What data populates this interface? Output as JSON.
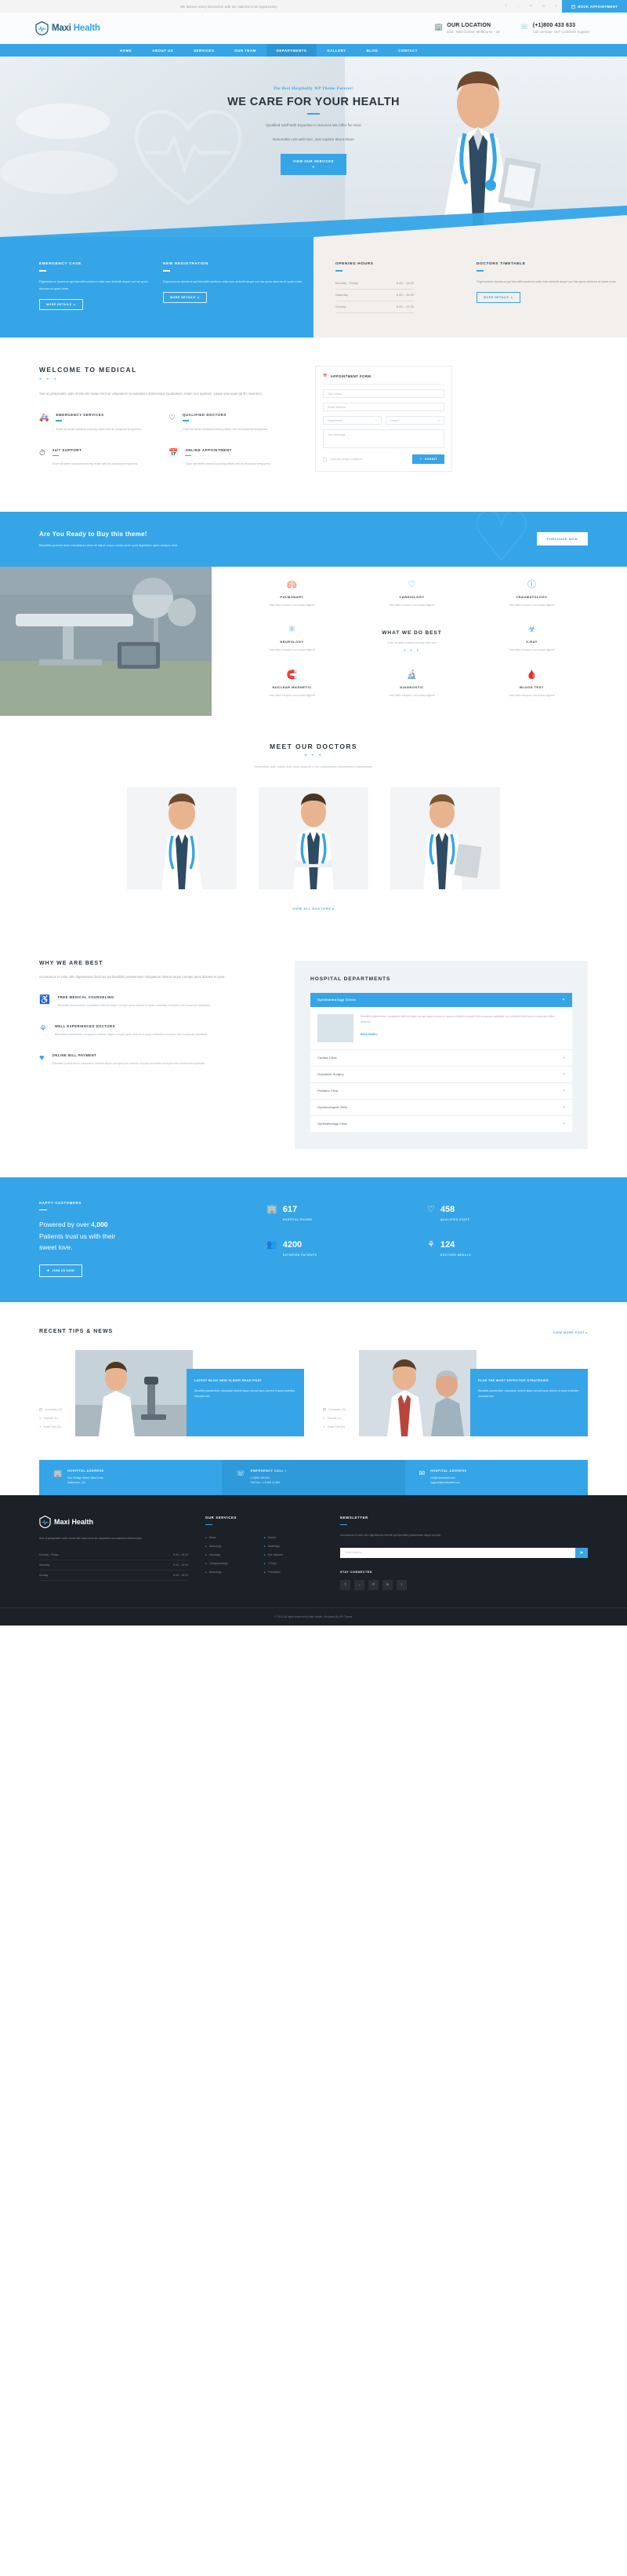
{
  "topbar": {
    "tagline": "We believe every interaction with our patients is an opportunity!",
    "socials": [
      "f",
      "ᵥ",
      "✕",
      "in",
      "t"
    ],
    "book_label": "BOOK APPOINTMENT",
    "book_icon": "calendar-icon"
  },
  "header": {
    "brand_first": "Maxi ",
    "brand_second": "Health",
    "contacts": [
      {
        "icon": "location-icon",
        "title": "OUR LOCATION",
        "sub": "Eaa - Web Corner, Melbourne - 18"
      },
      {
        "icon": "phone-icon",
        "title": "(+1)800 433 633",
        "sub": "Call Us Now- 24/7 Customer Support"
      }
    ]
  },
  "nav": {
    "items": [
      {
        "label": "HOME",
        "active": false
      },
      {
        "label": "ABOUT US",
        "active": false
      },
      {
        "label": "SERVICES",
        "active": false
      },
      {
        "label": "OUR TEAM",
        "active": false
      },
      {
        "label": "DEPARTMENTS",
        "active": true
      },
      {
        "label": "GALLERY",
        "active": false
      },
      {
        "label": "BLOG",
        "active": false
      },
      {
        "label": "CONTACT",
        "active": false
      }
    ]
  },
  "hero": {
    "kicker": "The Best Hospitality WP Theme Forever!",
    "title": "WE CARE FOR YOUR HEALTH",
    "subtitle_line1": "Qualified Staff With Expertise In Services We Offer for more",
    "subtitle_line2": "Resonable cost with love, Just explore about More!",
    "button": "VIEW OUR SERVICES",
    "button_arrow": "▾"
  },
  "info_boxes": [
    {
      "title": "EMERGENCY CASE",
      "body": "Dignissimos ducimus qui blanditii sentium volta tum deleniti atque corl as quos dolores et quas mole.",
      "button": "MORE DETAILS",
      "theme": "blue"
    },
    {
      "title": "NEW REGISTRATION",
      "body": "Dignissimos ducimus qui blanditii sentium volta tum deleniti atque corl as quos dolores et quas mole.",
      "button": "MORE DETAILS",
      "theme": "blue"
    },
    {
      "title": "OPENING HOURS",
      "theme": "light",
      "hours": [
        {
          "day": "Monday - Friday",
          "time": "8.00 – 18.00"
        },
        {
          "day": "Saturday",
          "time": "8.00 – 16.00"
        },
        {
          "day": "Sunday",
          "time": "8.00 – 15.00"
        }
      ]
    },
    {
      "title": "DOCTORS TIMETABLE",
      "body": "Dignissimos ducimus qui blanditii sentium volta tum deleniti atque corl las quos dolores et quas mole.",
      "button": "MORE DETAILS",
      "theme": "light"
    }
  ],
  "welcome": {
    "title": "WELCOME TO MEDICAL",
    "dots": "+ + +",
    "lead": "Sed ut perspiciatis unde omnis iste natus error sit voluptatem accusantium doloremque laudantium, totam rem aperiam, eaque ipsa quae ab illo inventore.",
    "features": [
      {
        "icon": "ambulance-icon",
        "title": "EMERGENCY SERVICES",
        "text": "Dolor sit amet consecti pısicing ellam sed do eiusmod temporinu."
      },
      {
        "icon": "heart-icon",
        "title": "QUALIFIED DOCTORS",
        "text": "Dolor sit amet consecti pısicing ellam sed do eiusmod temporinu."
      },
      {
        "icon": "clock-icon",
        "title": "24/7 SUPPORT",
        "text": "Dolor sit amet consecti pısicing ellam sed do eiusmod temporinu."
      },
      {
        "icon": "calendar-icon",
        "title": "ONLINE APPOINTMENT",
        "text": "Dolor sit amet consecti pısicing ellam sed do eiusmod temporinu."
      }
    ]
  },
  "appointment": {
    "heading": "APPOINTMENT FORM",
    "icon": "calendar-icon",
    "name_placeholder": "Your Name",
    "email_placeholder": "Email Address",
    "select_department": "Department",
    "select_doctor": "Doctor",
    "message_placeholder": "Your Message ...",
    "terms": "I read and accept conditions",
    "submit": "SUBMIT",
    "submit_icon": "check-icon"
  },
  "cta": {
    "title_a": "Are You Ready to ",
    "title_b": "Buy this theme!",
    "subtitle": "Blanditiis praesentium voluptatum deleniti atque corpo rutata dolor quia dignissim optio sanque nisit.",
    "button": "PURCHASE NOW"
  },
  "services": {
    "title": "WHAT WE DO BEST",
    "subtitle": "Dolor sit amet consecti pısicing ellam sed",
    "dots": "+ + +",
    "items": [
      {
        "icon": "lungs-icon",
        "title": "PULMONARY",
        "text": "Nam libero tempore cum soluta eligendi"
      },
      {
        "icon": "heart-icon",
        "title": "CARDIOLOGY",
        "text": "Nam libero tempore cum soluta eligendi"
      },
      {
        "icon": "ear-icon",
        "title": "TRAUMATOLOGY",
        "text": "Nam libero tempore cum soluta eligendi"
      },
      {
        "icon": "brain-icon",
        "title": "NEUROLOGY",
        "text": "Nam libero tempore cum soluta eligendi"
      },
      {
        "icon": "xray-icon",
        "title": "X-RAY",
        "text": "Nam libero tempore cum soluta eligendi"
      },
      {
        "icon": "magnet-icon",
        "title": "NUCLEAR MAGNETIC",
        "text": "Nam libero tempore cum soluta eligendi"
      },
      {
        "icon": "microscope-icon",
        "title": "DIAGNOSTIC",
        "text": "Nam libero tempore cum soluta eligendi"
      },
      {
        "icon": "blood-icon",
        "title": "BLOOD TEST",
        "text": "Nam libero tempore cum soluta eligendi"
      }
    ]
  },
  "doctors": {
    "title": "MEET OUR DOCTORS",
    "dots": "+ + +",
    "subtitle": "Temporibus aute quibis rend cilum solua error sitr voluptatetem accusantium praesentaqu.",
    "view_all": "VIEW ALL DOCTORS ▸",
    "cards": [
      {
        "name": "doctor-photo-1"
      },
      {
        "name": "doctor-photo-2"
      },
      {
        "name": "doctor-photo-3"
      }
    ]
  },
  "why": {
    "title": "WHY WE ARE BEST",
    "lead": "Accusamus et iusto odio dignissimos ducimus qui blanditiis praesentium voluptatum deleniti atque corrupti quos dolores et quas.",
    "items": [
      {
        "icon": "stethoscope-icon",
        "title": "FREE MEDICAL COUNSELING",
        "text": "Blanditiis praesentium voluptatum deleniti atque corrupti quos dolores et quas molestias excepturi sint occaecati cupiditate."
      },
      {
        "icon": "award-icon",
        "title": "WELL EXPERIENCED DOCTORS",
        "text": "Blanditiis praesentium voluptatum deleniti atque corrupti quos dolores et quas molestias excepturi sint occaecati cupiditate."
      },
      {
        "icon": "card-icon",
        "title": "ONLINE BILL PAYMENT",
        "text": "Blanditiis praesentium voluptatum deleniti atque corrupti quos dolores et quas molestias excepturi sint occaecati cupiditate."
      }
    ]
  },
  "departments": {
    "title": "HOSPITAL DEPARTMENTS",
    "open_item": {
      "label": "Ophthalmology Clinic",
      "sign": "+",
      "body": "Blanditiis praesentium voluptatum deleniti atque corrupti quos dolores et quas molestias excepturi sint occaecati cupiditate non provident simil sunt in culpa qui officia deserunt.",
      "read_more": "READ MORE ▸"
    },
    "items": [
      {
        "label": "Cardiac Clinic",
        "sign": "+"
      },
      {
        "label": "Outpatient Surgery",
        "sign": "+"
      },
      {
        "label": "Pediatric Clinic",
        "sign": "+"
      },
      {
        "label": "Gynaecological Clinic",
        "sign": "+"
      },
      {
        "label": "Ophthalmology Clinic",
        "sign": "+"
      }
    ]
  },
  "counters": {
    "kicker": "HAPPY CUSTOMERS",
    "headline_1": "Powered by over ",
    "headline_num": "4,000",
    "headline_2": "Patients trust us with their",
    "headline_3": "sweet love.",
    "join_label": "JOIN US NOW",
    "stats": [
      {
        "icon": "building-icon",
        "number": "617",
        "label": "HOSPITAL ROOMS"
      },
      {
        "icon": "heart-icon",
        "number": "458",
        "label": "QUALIFIED STAFF"
      },
      {
        "icon": "users-icon",
        "number": "4200",
        "label": "SATISFIED PATIENTS"
      },
      {
        "icon": "award-icon",
        "number": "124",
        "label": "DOCTORS MEDALS"
      }
    ]
  },
  "news": {
    "title": "RECENT TIPS & NEWS",
    "more_label": "VIEW MORE POST ▸",
    "posts": [
      {
        "image": "news-photo-microscope",
        "title": "LATEST BLOG NEW SLIDER READ POST",
        "text": "Blanditiis praesentium voluptatum deleniti atque corrupti quos dolores et quas molestias excepturi sint.",
        "meta": [
          {
            "icon": "comment-icon",
            "text": "Comments (10)"
          },
          {
            "icon": "heart-icon",
            "text": "Favorite (11)"
          },
          {
            "icon": "share-icon",
            "text": "Share Post (20)"
          }
        ]
      },
      {
        "image": "news-photo-consult",
        "title": "PLUS THE MOST EFFECTIVE STRATEGIES",
        "text": "Blanditiis praesentium voluptatum deleniti atque corrupti quos dolores et quas molestias excepturi sint.",
        "meta": [
          {
            "icon": "comment-icon",
            "text": "Comments (10)"
          },
          {
            "icon": "heart-icon",
            "text": "Favorite (11)"
          },
          {
            "icon": "share-icon",
            "text": "Share Post (20)"
          }
        ]
      }
    ]
  },
  "contact_bar": [
    {
      "icon": "location-icon",
      "title": "HOSPITAL ADDRESS",
      "lines": "Eaa Vintage Street, New Cross\nMelbourne - AU"
    },
    {
      "icon": "phone-icon",
      "title": "EMERGENCY CALL !",
      "lines": "(+1)800 433 633\nToll Free : 1-5 800 11 550"
    },
    {
      "icon": "mail-icon",
      "title": "HOSPITAL ADDRESS",
      "lines": "info@maxihealth.com\nsupport@maxihealth.com"
    }
  ],
  "footer": {
    "brand_first": "Maxi ",
    "brand_second": "Health",
    "about": "Sed ut perspiciatis unde omnis iste natus error sit voluptatem accusantium doloremque.",
    "hours": [
      {
        "day": "Monday - Friday",
        "time": "8.00 – 18.00"
      },
      {
        "day": "Saturday",
        "time": "8.00 – 16.00"
      },
      {
        "day": "Sunday",
        "time": "8.00 – 15.00"
      }
    ],
    "services_title": "OUR SERVICES",
    "services_col1": [
      "Nerve",
      "Neurology",
      "Oncology",
      "Transplantology",
      "Neurology"
    ],
    "services_col2": [
      "Dental",
      "Radiology",
      "Ear implants",
      "X-Rays",
      "Prosthesis"
    ],
    "newsletter_title": "NEWSLETTER",
    "newsletter_text": "Accusamus et iusto odio dignissimos deleniti qui blanditiis praesentium atque corrupti.",
    "newsletter_placeholder": "Email Address",
    "newsletter_button_icon": "send-icon",
    "follow_title": "STAY CONNECTED",
    "socials": [
      "f",
      "ᵥ",
      "✕",
      "in",
      "t"
    ],
    "copyright": "© 2018. All rights reserved by Maxi Health. Designed By WP Theme."
  }
}
